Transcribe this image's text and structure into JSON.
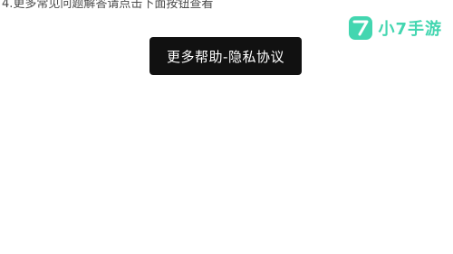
{
  "instruction": {
    "text": "4.更多常见问题解答请点击下面按钮查看"
  },
  "help_button": {
    "label": "更多帮助-隐私协议"
  },
  "watermark": {
    "brand_text": "小7手游",
    "logo_mark": "7",
    "accent_color": "#2fd2a8"
  }
}
